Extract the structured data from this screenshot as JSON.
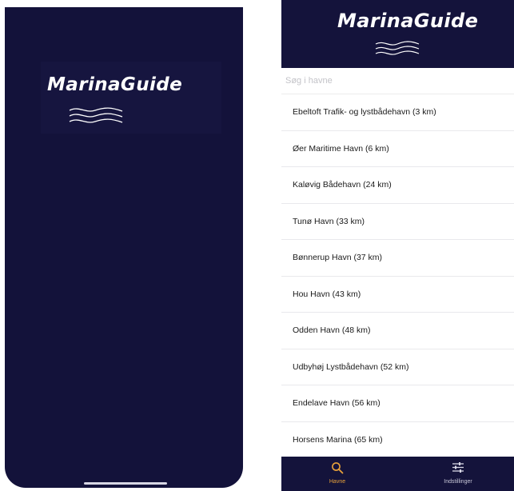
{
  "splash": {
    "app_title": "MarinaGuide"
  },
  "header": {
    "app_title": "MarinaGuide"
  },
  "search": {
    "placeholder": "Søg i havne"
  },
  "harbors": [
    "Ebeltoft Trafik- og lystbådehavn (3 km)",
    "Øer Maritime Havn (6 km)",
    "Kaløvig Bådehavn (24 km)",
    "Tunø Havn (33 km)",
    "Bønnerup Havn (37 km)",
    "Hou Havn (43 km)",
    "Odden Havn (48 km)",
    "Udbyhøj Lystbådehavn (52 km)",
    "Endelave Havn (56 km)",
    "Horsens Marina (65 km)"
  ],
  "tabs": [
    {
      "label": "Havne",
      "icon": "search-icon",
      "active": true
    },
    {
      "label": "Indstillinger",
      "icon": "sliders-icon",
      "active": false
    }
  ],
  "colors": {
    "navy": "#13123a",
    "accent": "#e9a23b"
  }
}
